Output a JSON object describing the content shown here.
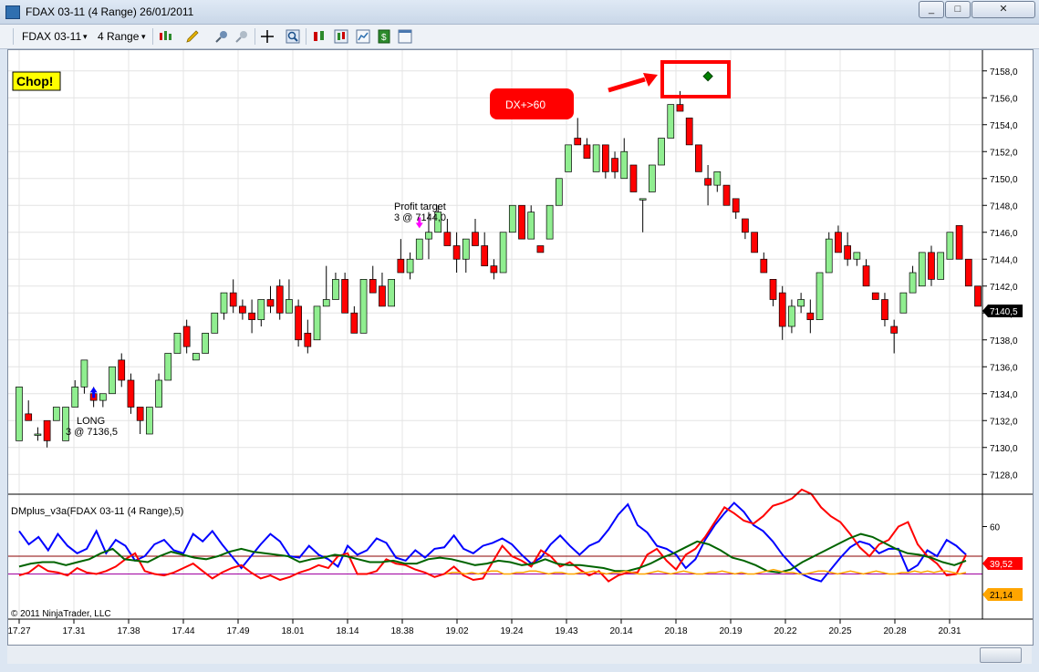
{
  "window": {
    "title": "FDAX 03-11 (4 Range)  26/01/2011",
    "controls": [
      "_",
      "□",
      "✕"
    ]
  },
  "toolbar": {
    "instrument": "FDAX 03-11",
    "interval": "4 Range",
    "icons": [
      "bar-type-icon",
      "drawing-tool-icon",
      "zoom-in-icon",
      "zoom-out-icon",
      "crosshair-icon",
      "magnify-icon",
      "strategies-icon",
      "indicators-icon",
      "chart-props-icon",
      "data-box-icon",
      "properties-icon"
    ]
  },
  "annotations": {
    "chop": "Chop!",
    "dx_callout": "DX+>60",
    "profit_target_1": "Profit target",
    "profit_target_2": "3 @ 7144,0",
    "long_1": "LONG",
    "long_2": "3 @ 7136,5",
    "indicator_title": "DMplus_v3a(FDAX 03-11 (4 Range),5)",
    "copyright": "© 2011 NinjaTrader, LLC"
  },
  "colors": {
    "up_candle": "#90ee90",
    "down_candle": "#ff0000",
    "dm_plus": "#0000ff",
    "dm_minus": "#ff0000",
    "adx": "#006400",
    "fourth_line": "#ffa500",
    "last_price_badge": "#000000",
    "callout": "#ff0000"
  },
  "chart_data": [
    {
      "type": "candlestick",
      "ylim": [
        7127,
        7159
      ],
      "y_ticks": [
        "7128,0",
        "7130,0",
        "7132,0",
        "7134,0",
        "7136,0",
        "7138,0",
        "7140,0",
        "7142,0",
        "7144,0",
        "7146,0",
        "7148,0",
        "7150,0",
        "7152,0",
        "7154,0",
        "7156,0",
        "7158,0"
      ],
      "x_ticks": [
        "17.27",
        "17.31",
        "17.38",
        "17.44",
        "17.49",
        "18.01",
        "18.14",
        "18.38",
        "19.02",
        "19.24",
        "19.43",
        "20.14",
        "20.18",
        "20.19",
        "20.22",
        "20.25",
        "20.28",
        "20.31"
      ],
      "last_price": "7140,5",
      "candles": [
        [
          7130.5,
          7134.5,
          7130.5,
          7134.5
        ],
        [
          7132.5,
          7133.5,
          7132.0,
          7132.0
        ],
        [
          7131.0,
          7131.5,
          7130.5,
          7131.0
        ],
        [
          7132.0,
          7132.0,
          7130.0,
          7130.5
        ],
        [
          7132.0,
          7133.0,
          7132.0,
          7133.0
        ],
        [
          7130.5,
          7133.0,
          7130.5,
          7133.0
        ],
        [
          7133.0,
          7135.0,
          7133.0,
          7134.5
        ],
        [
          7134.5,
          7136.5,
          7134.0,
          7136.5
        ],
        [
          7134.0,
          7134.5,
          7133.0,
          7133.5
        ],
        [
          7133.5,
          7134.0,
          7133.0,
          7134.0
        ],
        [
          7134.0,
          7136.0,
          7134.0,
          7136.0
        ],
        [
          7136.5,
          7137.0,
          7134.5,
          7135.0
        ],
        [
          7135.0,
          7135.5,
          7132.5,
          7133.0
        ],
        [
          7133.0,
          7133.0,
          7131.0,
          7132.0
        ],
        [
          7131.0,
          7133.0,
          7131.0,
          7133.0
        ],
        [
          7133.0,
          7135.5,
          7133.0,
          7135.0
        ],
        [
          7135.0,
          7137.0,
          7135.0,
          7137.0
        ],
        [
          7137.0,
          7138.5,
          7137.0,
          7138.5
        ],
        [
          7139.0,
          7139.5,
          7137.0,
          7137.5
        ],
        [
          7136.5,
          7137.0,
          7136.5,
          7137.0
        ],
        [
          7137.0,
          7138.5,
          7137.0,
          7138.5
        ],
        [
          7138.5,
          7140.0,
          7138.5,
          7140.0
        ],
        [
          7140.0,
          7141.5,
          7139.5,
          7141.5
        ],
        [
          7141.5,
          7142.5,
          7140.0,
          7140.5
        ],
        [
          7140.5,
          7141.0,
          7139.5,
          7140.0
        ],
        [
          7140.0,
          7141.0,
          7138.5,
          7139.5
        ],
        [
          7139.5,
          7141.0,
          7139.0,
          7141.0
        ],
        [
          7141.0,
          7142.0,
          7140.0,
          7140.5
        ],
        [
          7142.0,
          7142.5,
          7139.5,
          7140.0
        ],
        [
          7140.0,
          7142.5,
          7140.0,
          7141.0
        ],
        [
          7140.5,
          7141.0,
          7137.5,
          7138.0
        ],
        [
          7138.5,
          7139.5,
          7137.0,
          7137.5
        ],
        [
          7138.0,
          7140.5,
          7138.0,
          7140.5
        ],
        [
          7140.5,
          7143.5,
          7140.5,
          7141.0
        ],
        [
          7141.0,
          7143.0,
          7141.0,
          7142.5
        ],
        [
          7142.5,
          7143.0,
          7140.0,
          7140.0
        ],
        [
          7140.0,
          7140.5,
          7138.5,
          7138.5
        ],
        [
          7138.5,
          7142.5,
          7138.5,
          7142.5
        ],
        [
          7142.5,
          7143.5,
          7141.5,
          7141.5
        ],
        [
          7142.0,
          7143.0,
          7141.0,
          7140.5
        ],
        [
          7140.5,
          7142.5,
          7140.5,
          7142.5
        ],
        [
          7144.0,
          7145.5,
          7143.0,
          7143.0
        ],
        [
          7143.0,
          7144.5,
          7142.5,
          7144.0
        ],
        [
          7144.0,
          7145.5,
          7144.0,
          7145.5
        ],
        [
          7145.5,
          7147.5,
          7144.0,
          7146.0
        ],
        [
          7146.0,
          7148.0,
          7146.0,
          7147.5
        ],
        [
          7146.0,
          7147.0,
          7145.0,
          7145.0
        ],
        [
          7145.0,
          7146.0,
          7143.0,
          7144.0
        ],
        [
          7144.0,
          7145.5,
          7143.0,
          7145.5
        ],
        [
          7146.0,
          7147.0,
          7145.5,
          7145.0
        ],
        [
          7145.0,
          7146.0,
          7143.5,
          7143.5
        ],
        [
          7143.5,
          7144.0,
          7142.5,
          7143.0
        ],
        [
          7143.0,
          7146.0,
          7143.0,
          7146.0
        ],
        [
          7146.0,
          7148.0,
          7146.0,
          7148.0
        ],
        [
          7148.0,
          7148.0,
          7145.5,
          7145.5
        ],
        [
          7145.5,
          7148.0,
          7145.5,
          7147.5
        ],
        [
          7145.0,
          7145.0,
          7144.5,
          7144.5
        ],
        [
          7145.5,
          7148.0,
          7145.5,
          7148.0
        ],
        [
          7148.0,
          7150.0,
          7148.0,
          7150.0
        ],
        [
          7150.5,
          7152.5,
          7150.5,
          7152.5
        ],
        [
          7153.0,
          7154.5,
          7152.5,
          7152.5
        ],
        [
          7152.5,
          7153.0,
          7151.5,
          7151.5
        ],
        [
          7150.5,
          7152.5,
          7150.5,
          7152.5
        ],
        [
          7152.5,
          7152.5,
          7150.0,
          7150.5
        ],
        [
          7151.5,
          7152.0,
          7150.0,
          7150.5
        ],
        [
          7150.0,
          7153.0,
          7150.0,
          7152.0
        ],
        [
          7151.0,
          7151.0,
          7149.0,
          7149.0
        ],
        [
          7148.5,
          7148.5,
          7146.0,
          7148.5
        ],
        [
          7149.0,
          7151.0,
          7149.0,
          7151.0
        ],
        [
          7151.0,
          7153.0,
          7151.0,
          7153.0
        ],
        [
          7153.0,
          7155.5,
          7153.0,
          7155.5
        ],
        [
          7155.5,
          7156.5,
          7155.0,
          7155.0
        ],
        [
          7154.5,
          7154.5,
          7152.5,
          7152.5
        ],
        [
          7152.5,
          7152.5,
          7150.5,
          7150.5
        ],
        [
          7150.0,
          7151.0,
          7148.0,
          7149.5
        ],
        [
          7149.5,
          7150.5,
          7149.0,
          7150.5
        ],
        [
          7149.5,
          7149.5,
          7148.0,
          7148.0
        ],
        [
          7148.5,
          7148.5,
          7147.0,
          7147.5
        ],
        [
          7147.0,
          7147.0,
          7145.5,
          7146.0
        ],
        [
          7146.0,
          7146.0,
          7144.5,
          7144.5
        ],
        [
          7144.0,
          7144.5,
          7143.0,
          7143.0
        ],
        [
          7142.5,
          7142.5,
          7140.5,
          7141.0
        ],
        [
          7141.5,
          7142.0,
          7138.0,
          7139.0
        ],
        [
          7139.0,
          7141.0,
          7138.5,
          7140.5
        ],
        [
          7140.5,
          7141.5,
          7140.0,
          7141.0
        ],
        [
          7140.0,
          7141.0,
          7138.5,
          7139.5
        ],
        [
          7139.5,
          7143.0,
          7139.5,
          7143.0
        ],
        [
          7143.0,
          7146.0,
          7143.0,
          7145.5
        ],
        [
          7146.0,
          7146.5,
          7144.5,
          7144.5
        ],
        [
          7145.0,
          7146.0,
          7143.5,
          7144.0
        ],
        [
          7144.0,
          7144.5,
          7143.5,
          7144.5
        ],
        [
          7143.5,
          7144.0,
          7142.0,
          7142.0
        ],
        [
          7141.5,
          7141.5,
          7141.0,
          7141.0
        ],
        [
          7141.0,
          7141.5,
          7139.0,
          7139.5
        ],
        [
          7139.0,
          7139.5,
          7137.0,
          7138.5
        ],
        [
          7140.0,
          7141.5,
          7140.0,
          7141.5
        ],
        [
          7141.5,
          7143.5,
          7141.5,
          7143.0
        ],
        [
          7142.0,
          7144.5,
          7142.0,
          7144.5
        ],
        [
          7144.5,
          7145.0,
          7142.0,
          7142.5
        ],
        [
          7142.5,
          7144.5,
          7142.5,
          7144.5
        ],
        [
          7144.0,
          7146.0,
          7144.0,
          7146.0
        ],
        [
          7146.5,
          7146.5,
          7144.0,
          7144.0
        ],
        [
          7144.0,
          7144.0,
          7142.0,
          7142.0
        ],
        [
          7142.0,
          7142.0,
          7140.5,
          7140.5
        ]
      ],
      "signals": {
        "long_arrow": {
          "index": 8,
          "price": 7134.5
        },
        "profit_arrow": {
          "index": 43,
          "price": 7146.3
        },
        "dx_marker": {
          "index": 74,
          "price": 7157.6
        }
      }
    },
    {
      "type": "line",
      "ylim": [
        0,
        80
      ],
      "y_ticks": [
        "60"
      ],
      "reference_lines": [
        40,
        28
      ],
      "badges": [
        "39,52",
        "21,14"
      ],
      "series": [
        {
          "values": [
            57,
            48,
            53,
            44,
            55,
            47,
            42,
            45,
            57,
            42,
            51,
            47,
            37,
            40,
            48,
            51,
            44,
            42,
            55,
            50,
            57,
            48,
            40,
            32,
            40,
            48,
            55,
            50,
            40,
            39,
            47,
            41,
            38,
            33,
            47,
            41,
            44,
            52,
            49,
            39,
            37,
            44,
            39,
            45,
            46,
            54,
            45,
            42,
            47,
            49,
            52,
            48,
            41,
            35,
            39,
            48,
            54,
            47,
            41,
            47,
            50,
            58,
            68,
            75,
            61,
            56,
            47,
            45,
            41,
            32,
            38,
            51,
            61,
            69,
            76,
            70,
            61,
            57,
            50,
            41,
            34,
            28,
            25,
            23,
            31,
            39,
            46,
            50,
            48,
            42,
            45,
            45,
            30,
            34,
            44,
            40,
            51,
            47,
            41
          ]
        },
        {
          "values": [
            27,
            29,
            34,
            30,
            29,
            27,
            32,
            29,
            28,
            30,
            33,
            38,
            42,
            30,
            28,
            27,
            29,
            32,
            35,
            30,
            25,
            29,
            32,
            34,
            29,
            25,
            27,
            24,
            26,
            29,
            31,
            34,
            32,
            40,
            42,
            28,
            28,
            30,
            38,
            35,
            34,
            31,
            29,
            26,
            28,
            33,
            27,
            24,
            25,
            36,
            47,
            40,
            37,
            33,
            44,
            40,
            33,
            36,
            31,
            27,
            30,
            23,
            27,
            29,
            29,
            41,
            45,
            37,
            31,
            41,
            45,
            53,
            63,
            73,
            69,
            64,
            62,
            67,
            74,
            76,
            79,
            85,
            82,
            73,
            67,
            63,
            55,
            46,
            40,
            48,
            51,
            60,
            63,
            48,
            40,
            35,
            27,
            28,
            41
          ]
        },
        {
          "values": [
            33,
            35,
            36,
            36,
            34,
            36,
            38,
            42,
            45,
            38,
            37,
            36,
            40,
            43,
            41,
            39,
            38,
            40,
            43,
            45,
            43,
            42,
            41,
            40,
            36,
            38,
            39,
            41,
            40,
            38,
            36,
            36,
            37,
            35,
            35,
            38,
            39,
            38,
            36,
            34,
            35,
            37,
            36,
            34,
            35,
            38,
            35,
            34,
            34,
            33,
            32,
            30,
            30,
            32,
            35,
            39,
            42,
            46,
            50,
            48,
            44,
            39,
            37,
            34,
            30,
            29,
            31,
            36,
            40,
            44,
            48,
            52,
            55,
            53,
            49,
            45,
            42,
            41,
            39,
            36,
            34,
            37
          ]
        },
        {
          "values": [
            28,
            29,
            29,
            28,
            29,
            28,
            29,
            30,
            30,
            28,
            28,
            29,
            29,
            30,
            30,
            29,
            28,
            29,
            29,
            28,
            28,
            29,
            29,
            30,
            29,
            28,
            29,
            29,
            30,
            29,
            28,
            28,
            29,
            30,
            29,
            28,
            29,
            30,
            29,
            28,
            28,
            29,
            29,
            30,
            29,
            28,
            29,
            28,
            28,
            29,
            30,
            31,
            30,
            29,
            29,
            28,
            28,
            29,
            30,
            30,
            29,
            28,
            29,
            30,
            29,
            28,
            29,
            30,
            29,
            28,
            28,
            29,
            29,
            30,
            29,
            30,
            29,
            30,
            30,
            29,
            28,
            29
          ]
        }
      ]
    }
  ]
}
